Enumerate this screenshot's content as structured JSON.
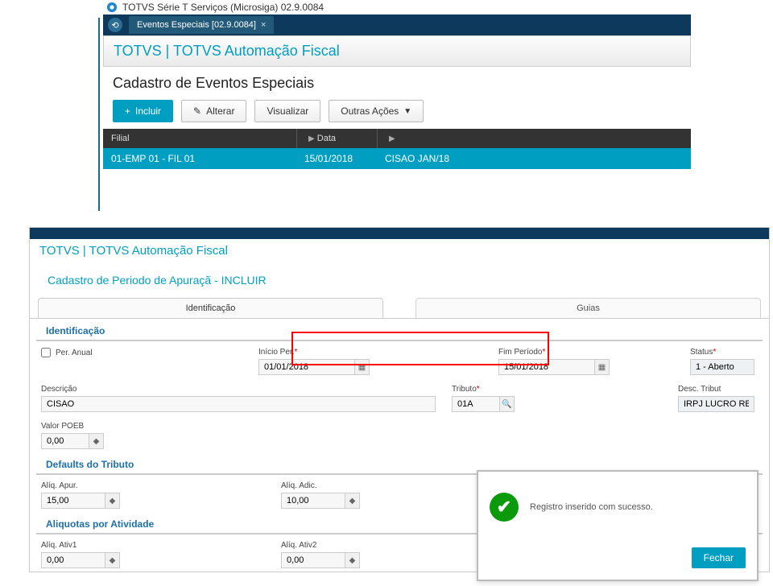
{
  "window_title": "TOTVS Série T Serviços (Microsiga) 02.9.0084",
  "tab_label": "Eventos Especiais [02.9.0084]",
  "breadcrumb": "TOTVS | TOTVS Automação Fiscal",
  "page_title": "Cadastro de Eventos Especiais",
  "toolbar": {
    "incluir": "Incluir",
    "alterar": "Alterar",
    "visualizar": "Visualizar",
    "outras_acoes": "Outras Ações"
  },
  "grid": {
    "headers": {
      "filial": "Filial",
      "data": "Data"
    },
    "row": {
      "filial": "01-EMP 01 - FIL 01",
      "data": "15/01/2018",
      "desc": "CISAO JAN/18"
    }
  },
  "screen2": {
    "breadcrumb": "TOTVS | TOTVS Automação Fiscal",
    "title": "Cadastro de Periodo de Apuraçã - INCLUIR",
    "tabs": {
      "ident": "Identificação",
      "guias": "Guias"
    },
    "section_ident": "Identificação",
    "per_anual_label": "Per. Anual",
    "inicio_per_label": "Início Per.",
    "inicio_per_value": "01/01/2018",
    "fim_per_label": "Fim Período",
    "fim_per_value": "15/01/2018",
    "status_label": "Status",
    "status_value": "1 - Aberto",
    "descricao_label": "Descrição",
    "descricao_value": "CISAO",
    "tributo_label": "Tributo",
    "tributo_value": "01A",
    "desc_tribut_label": "Desc. Tribut",
    "desc_tribut_value": "IRPJ LUCRO REAL",
    "valor_poeb_label": "Valor POEB",
    "valor_poeb_value": "0,00",
    "section_defaults": "Defaults do Tributo",
    "aliq_apur_label": "Alíq. Apur.",
    "aliq_apur_value": "15,00",
    "aliq_adic_label": "Alíq. Adic.",
    "aliq_adic_value": "10,00",
    "section_aliq_ativ": "Aliquotas por Atividade",
    "aliq_ativ1_label": "Alíq. Ativ1",
    "aliq_ativ1_value": "0,00",
    "aliq_ativ2_label": "Alíq. Ativ2",
    "aliq_ativ2_value": "0,00"
  },
  "dialog": {
    "message": "Registro inserido com sucesso.",
    "close": "Fechar"
  }
}
